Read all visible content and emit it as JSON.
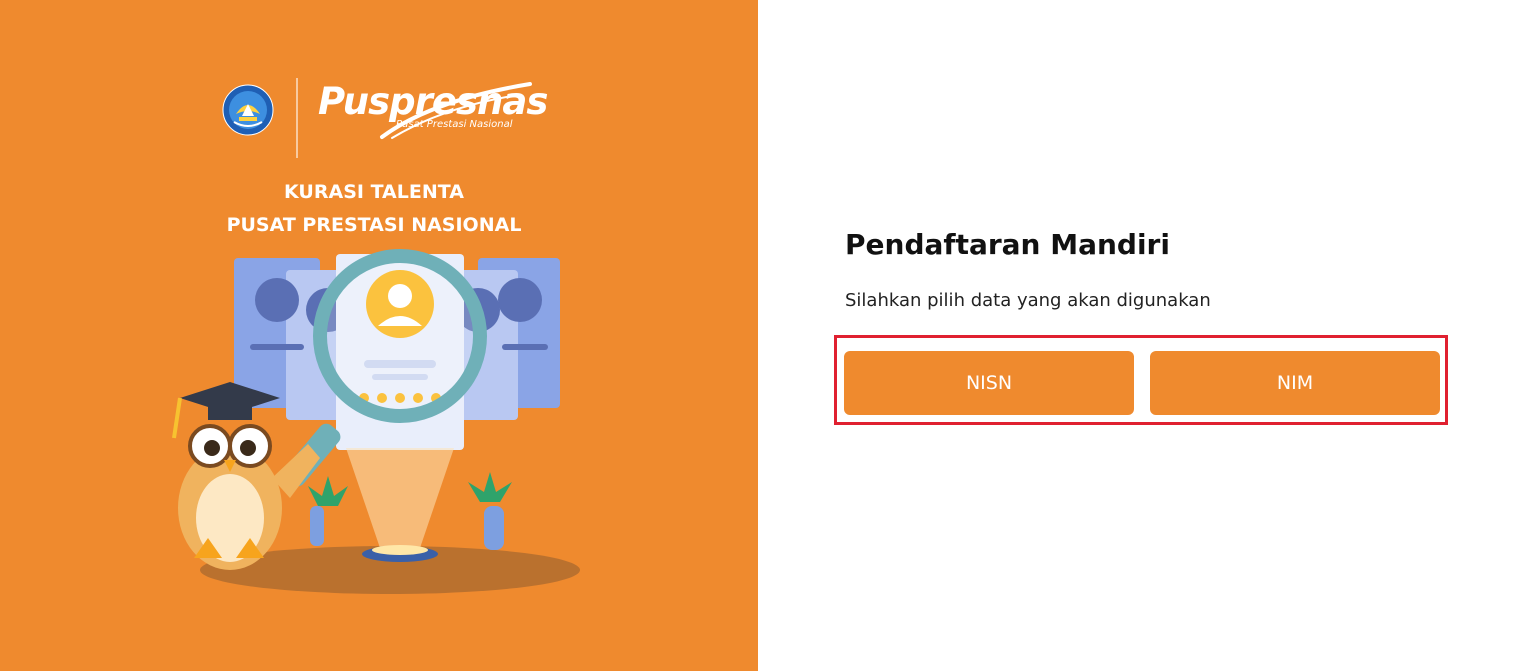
{
  "brand": {
    "name": "Puspresnas",
    "tagline": "Pusat Prestasi Nasional"
  },
  "headline": {
    "line1": "KURASI TALENTA",
    "line2": "PUSAT PRESTASI NASIONAL"
  },
  "form": {
    "title": "Pendaftaran Mandiri",
    "subtitle": "Silahkan pilih data yang akan digunakan",
    "options": [
      "NISN",
      "NIM"
    ]
  },
  "colors": {
    "accent": "#ef8a2e",
    "highlight_border": "#e02030",
    "panel_text": "#ffffff"
  },
  "icons": {
    "emblem": "tut-wuri-handayani-emblem",
    "illustration": "owl-magnifier-profile-cards"
  }
}
